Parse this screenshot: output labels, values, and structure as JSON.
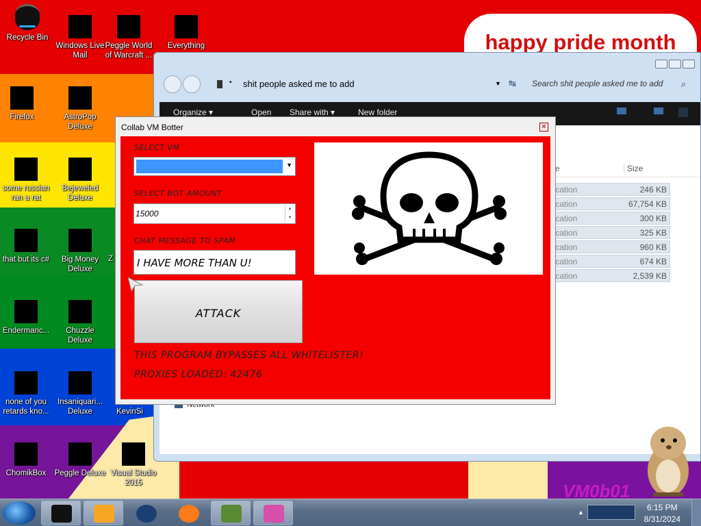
{
  "desktop": {
    "banner_text": "happy pride month",
    "icons": [
      {
        "label": "Recycle Bin"
      },
      {
        "label": "Windows Live Mail"
      },
      {
        "label": "Peggle World of Warcraft ..."
      },
      {
        "label": "Everything"
      },
      {
        "label": "Firefox"
      },
      {
        "label": "AstroPop Deluxe"
      },
      {
        "label": "some russian ran a rat"
      },
      {
        "label": "Bejeweled Deluxe"
      },
      {
        "label": "that but its c#"
      },
      {
        "label": "Big Money Deluxe"
      },
      {
        "label": "Endermanc..."
      },
      {
        "label": "Chuzzle Deluxe"
      },
      {
        "label": "none of you retards kno..."
      },
      {
        "label": "Insaniquari... Deluxe"
      },
      {
        "label": "ChomikBox"
      },
      {
        "label": "Peggle Deluxe"
      },
      {
        "label": "Visual Studio 2015"
      }
    ],
    "partial_labels": [
      "KevinSi",
      "Z"
    ],
    "watermark": "VM0b01"
  },
  "explorer": {
    "address": "shit people asked me to add",
    "search_placeholder": "Search shit people asked me to add",
    "toolbar": {
      "organize": "Organize ▾",
      "open": "Open",
      "share": "Share with ▾",
      "new_folder": "New folder"
    },
    "size_header": "Size",
    "nav_network": "Network",
    "files": [
      {
        "type": "lication",
        "size": "246 KB"
      },
      {
        "type": "lication",
        "size": "67,754 KB"
      },
      {
        "type": "lication",
        "size": "300 KB"
      },
      {
        "type": "lication",
        "size": "325 KB"
      },
      {
        "type": "lication",
        "size": "960 KB"
      },
      {
        "type": "lication",
        "size": "674 KB"
      },
      {
        "type": "lication",
        "size": "2,539 KB"
      }
    ]
  },
  "botter": {
    "title": "Collab VM Botter",
    "select_vm_label": "SELECT VM",
    "bot_amount_label": "SELECT BOT AMOUNT",
    "bot_amount_value": "15000",
    "chat_label": "CHAT MESSAGE TO SPAM",
    "chat_value": "I HAVE MORE THAN U!",
    "attack_label": "ATTACK",
    "bypass_text": "THIS PROGRAM BYPASSES ALL WHITELISTER!",
    "proxies_text": "PROXIES LOADED: 42476"
  },
  "taskbar": {
    "time": "6:15 PM",
    "date": "8/31/2024"
  },
  "colors": {
    "dialog_red": "#f50000",
    "combo_blue": "#3d95ff",
    "banner_red": "#d10f10"
  }
}
